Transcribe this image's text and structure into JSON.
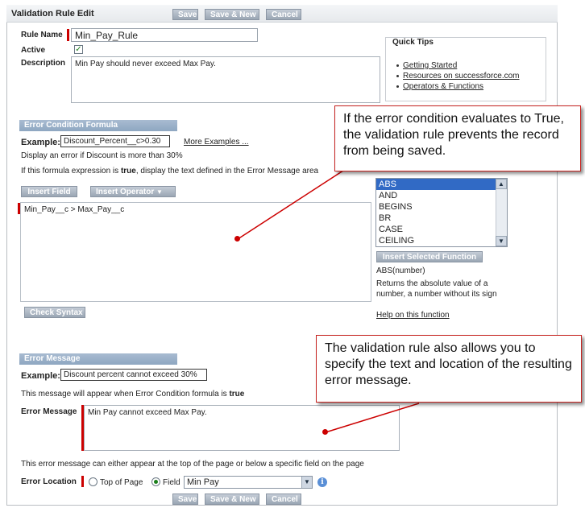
{
  "header": {
    "title": "Validation Rule Edit",
    "save_label": "Save",
    "save_new_label": "Save & New",
    "cancel_label": "Cancel"
  },
  "form": {
    "rule_name_label": "Rule Name",
    "rule_name_value": "Min_Pay_Rule",
    "active_label": "Active",
    "active_checked": true,
    "description_label": "Description",
    "description_value": "Min Pay should never exceed Max Pay."
  },
  "quick_tips": {
    "title": "Quick Tips",
    "links": [
      "Getting Started",
      "Resources on successforce.com",
      "Operators & Functions"
    ]
  },
  "error_condition": {
    "section_title": "Error Condition Formula",
    "example_label": "Example:",
    "example_value": "Discount_Percent__c>0.30",
    "more_examples_link": "More Examples ...",
    "example_desc": "Display an error if Discount is more than 30%",
    "instruction_prefix": "If this formula expression is ",
    "instruction_bold": "true",
    "instruction_suffix": ", display the text defined in the Error Message area",
    "insert_field_label": "Insert Field",
    "insert_operator_label": "Insert Operator",
    "formula_value": "Min_Pay__c > Max_Pay__c",
    "check_syntax_label": "Check Syntax",
    "functions": [
      "ABS",
      "AND",
      "BEGINS",
      "BR",
      "CASE",
      "CEILING"
    ],
    "selected_function": "ABS",
    "insert_function_label": "Insert Selected Function",
    "function_signature": "ABS(number)",
    "function_desc_line1": "Returns the absolute value of a",
    "function_desc_line2": "number, a number without its sign",
    "help_link": "Help on this function"
  },
  "error_message": {
    "section_title": "Error Message",
    "example_label": "Example:",
    "example_value": "Discount percent cannot exceed 30%",
    "note_prefix": "This message will appear when Error Condition formula is ",
    "note_bold": "true",
    "message_label": "Error Message",
    "message_value": "Min Pay cannot exceed Max Pay.",
    "location_note": "This error message can either appear at the top of the page or below a specific field on the page",
    "location_label": "Error Location",
    "option_top": "Top of Page",
    "option_field": "Field",
    "field_select_value": "Min Pay"
  },
  "callouts": {
    "condition_text": "If the error condition evaluates to True, the validation rule prevents the record from being saved.",
    "message_text": "The validation rule also allows you to specify the text and location of the resulting error message."
  },
  "icons": {
    "check": "check-icon",
    "chevron": "chevron-down-icon",
    "info": "info-icon"
  },
  "colors": {
    "section_bar": "#8ea7c1",
    "required_marker": "#cc0000",
    "callout_border": "#c5221f",
    "list_selection": "#316ac5"
  }
}
